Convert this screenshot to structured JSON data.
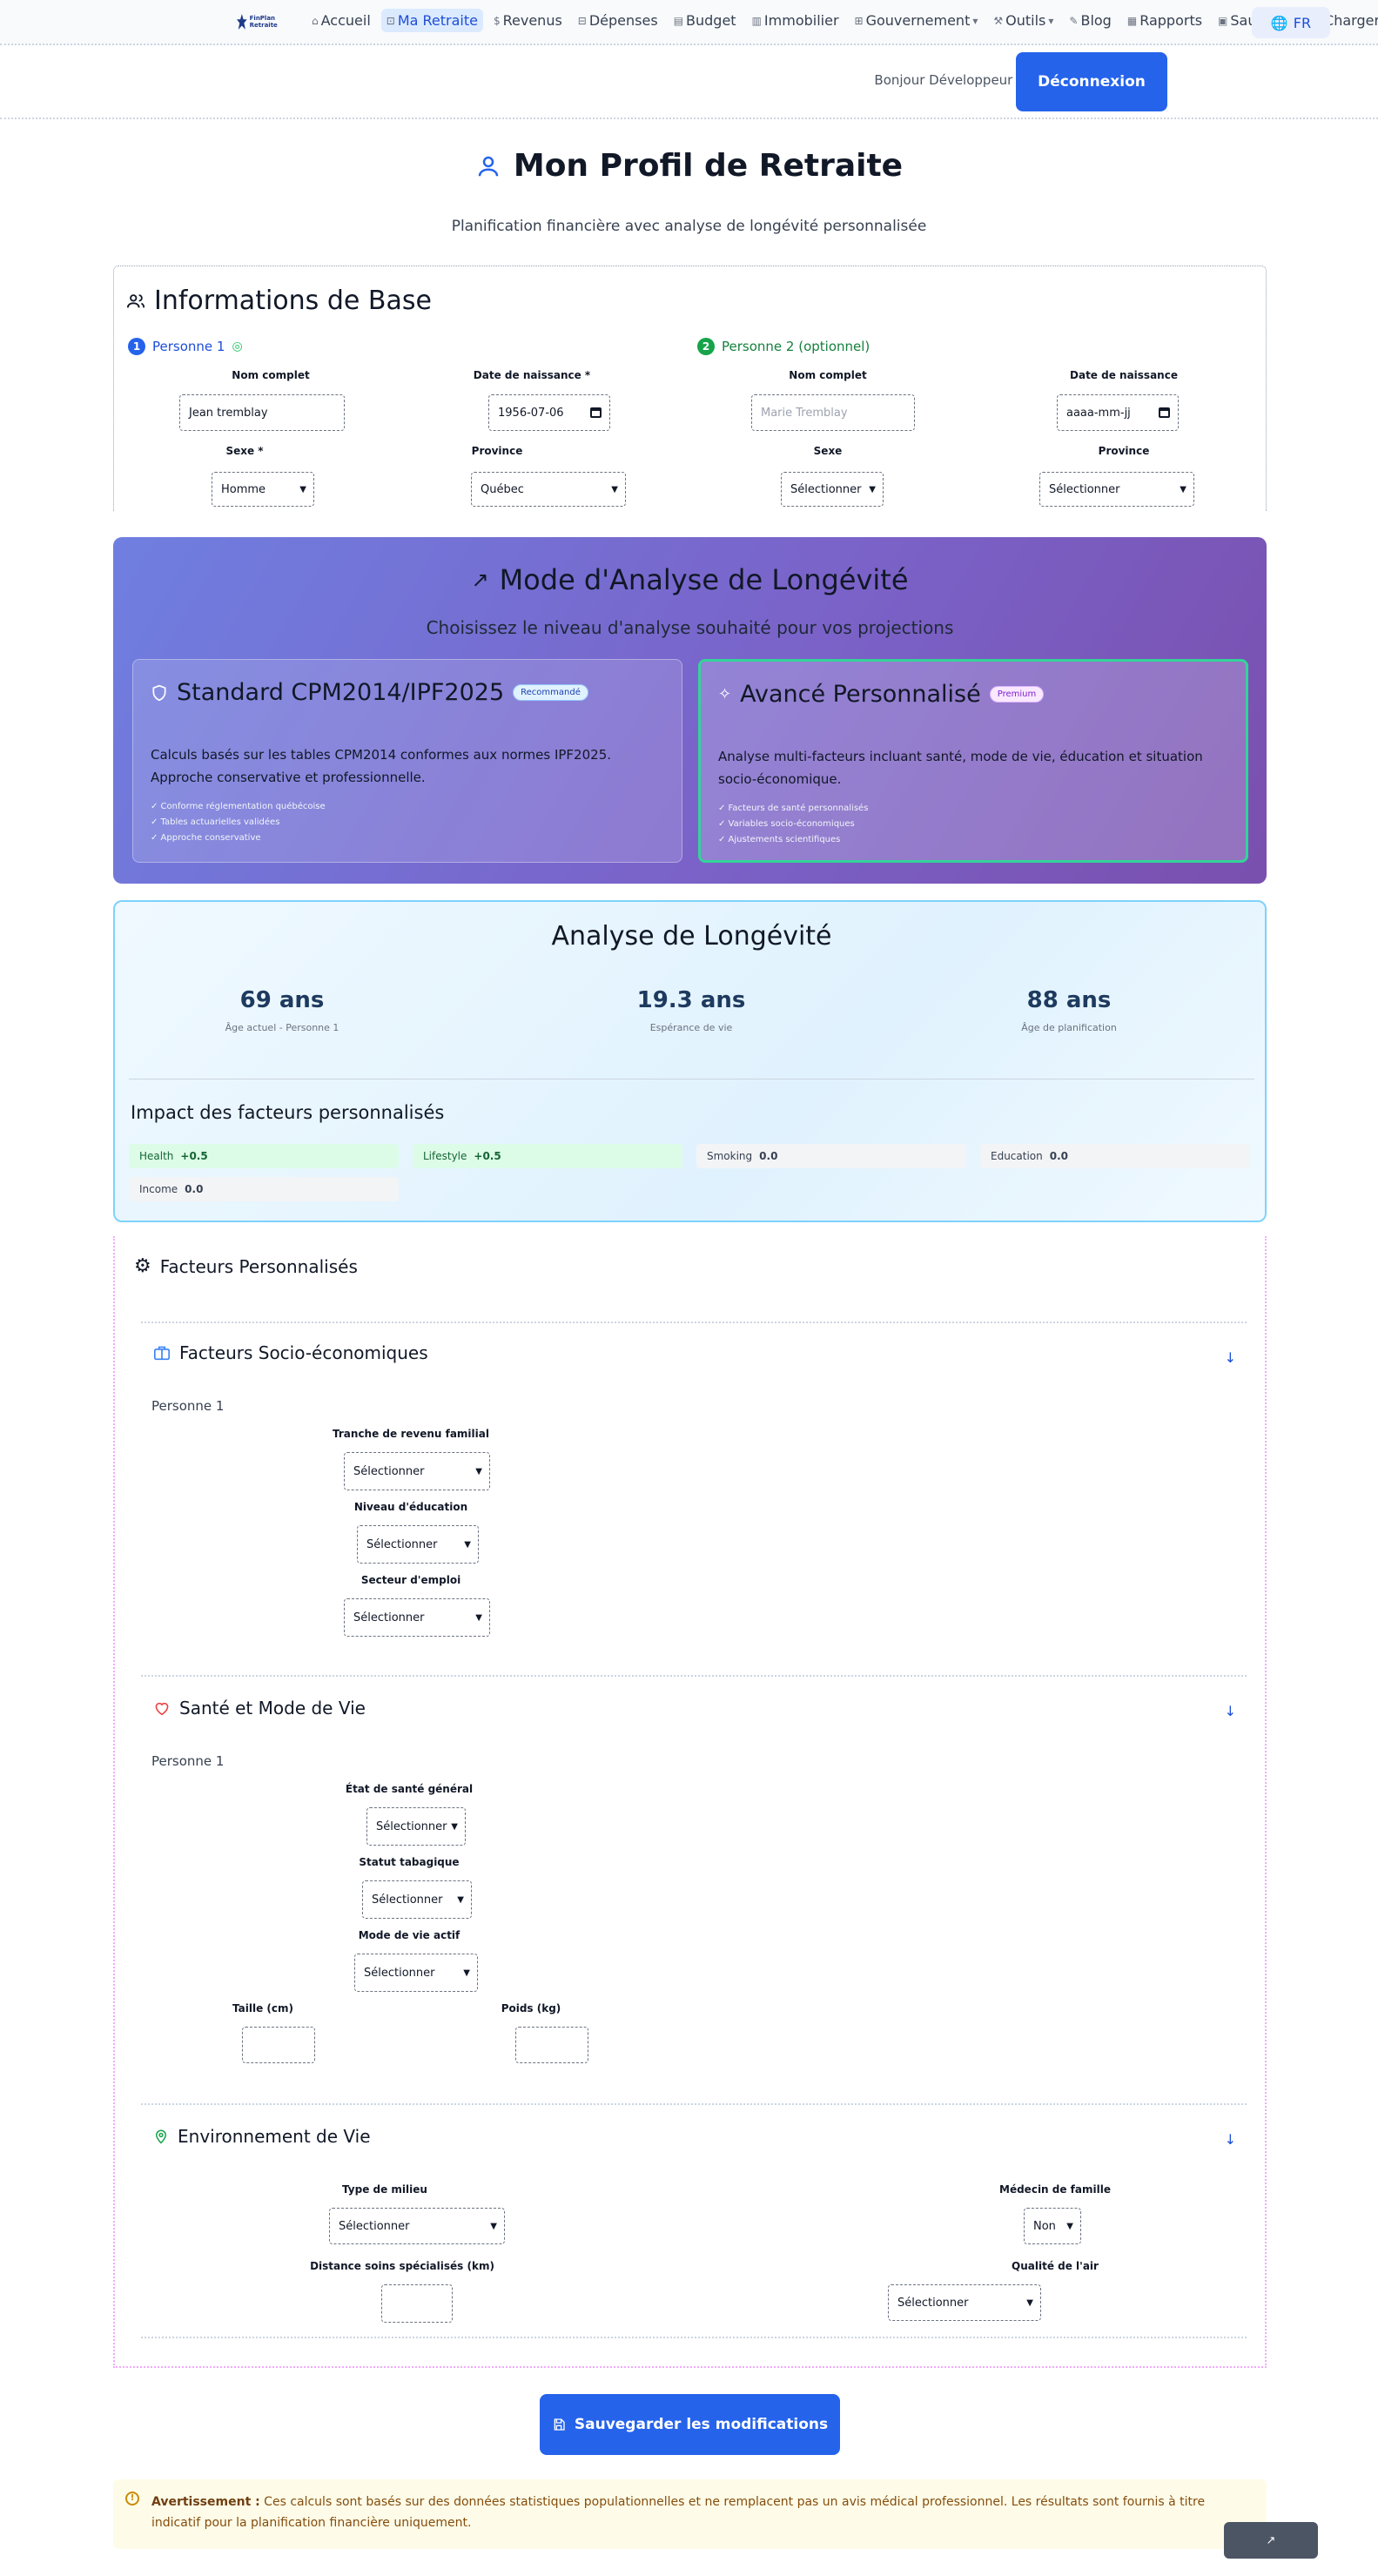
{
  "nav": {
    "logo_text": "FinPlan Retraite",
    "items": [
      {
        "icon": "home-icon",
        "label": "Accueil"
      },
      {
        "icon": "chart-icon",
        "label": "Ma Retraite"
      },
      {
        "icon": "dollar-icon",
        "label": "Revenus"
      },
      {
        "icon": "expense-icon",
        "label": "Dépenses"
      },
      {
        "icon": "budget-icon",
        "label": "Budget"
      },
      {
        "icon": "building-icon",
        "label": "Immobilier"
      },
      {
        "icon": "government-icon",
        "label": "Gouvernement"
      },
      {
        "icon": "tools-icon",
        "label": "Outils"
      },
      {
        "icon": "blog-icon",
        "label": "Blog"
      },
      {
        "icon": "reports-icon",
        "label": "Rapports"
      },
      {
        "icon": "save-icon",
        "label": "Sauvegarder/Charger"
      }
    ],
    "active_index": 1,
    "lang": "FR"
  },
  "user": {
    "greeting": "Bonjour Développeur Local",
    "logout": "Déconnexion"
  },
  "page": {
    "title": "Mon Profil de Retraite",
    "subtitle": "Planification financière avec analyse de longévité personnalisée"
  },
  "base_info": {
    "title": "Informations de Base",
    "person1": {
      "label": "Personne 1",
      "num": "1"
    },
    "person2": {
      "label": "Personne 2 (optionnel)",
      "num": "2"
    },
    "labels": {
      "name": "Nom complet",
      "dob_req": "Date de naissance *",
      "dob": "Date de naissance",
      "sex_req": "Sexe *",
      "sex": "Sexe",
      "province": "Province"
    },
    "p1": {
      "name": "Jean tremblay",
      "dob": "1956-07-06",
      "sex": "Homme",
      "province": "Québec"
    },
    "p2": {
      "name_placeholder": "Marie Tremblay",
      "dob_placeholder": "aaaa-mm-jj",
      "sex": "Sélectionner",
      "province": "Sélectionner"
    }
  },
  "mode": {
    "title": "Mode d'Analyse de Longévité",
    "subtitle": "Choisissez le niveau d'analyse souhaité pour vos projections",
    "standard": {
      "title": "Standard CPM2014/IPF2025",
      "badge": "Recommandé",
      "desc": "Calculs basés sur les tables CPM2014 conformes aux normes IPF2025. Approche conservative et professionnelle.",
      "bullets": [
        "✓ Conforme réglementation québécoise",
        "✓ Tables actuarielles validées",
        "✓ Approche conservative"
      ]
    },
    "advanced": {
      "title": "Avancé Personnalisé",
      "badge": "Premium",
      "desc": "Analyse multi-facteurs incluant santé, mode de vie, éducation et situation socio-économique.",
      "bullets": [
        "✓ Facteurs de santé personnalisés",
        "✓ Variables socio-économiques",
        "✓ Ajustements scientifiques"
      ]
    }
  },
  "analysis": {
    "title": "Analyse de Longévité",
    "stats": [
      {
        "value": "69 ans",
        "label": "Âge actuel - Personne 1"
      },
      {
        "value": "19.3 ans",
        "label": "Espérance de vie"
      },
      {
        "value": "88 ans",
        "label": "Âge de planification"
      }
    ],
    "impact_title": "Impact des facteurs personnalisés",
    "impacts": [
      {
        "name": "Health",
        "value": "+0.5",
        "kind": "pos"
      },
      {
        "name": "Lifestyle",
        "value": "+0.5",
        "kind": "pos"
      },
      {
        "name": "Smoking",
        "value": "0.0",
        "kind": "neu"
      },
      {
        "name": "Education",
        "value": "0.0",
        "kind": "neu"
      },
      {
        "name": "Income",
        "value": "0.0",
        "kind": "neu"
      }
    ]
  },
  "factors": {
    "title": "Facteurs Personnalisés",
    "socio": {
      "title": "Facteurs Socio-économiques",
      "person": "Personne 1",
      "income_label": "Tranche de revenu familial",
      "income": "Sélectionner",
      "edu_label": "Niveau d'éducation",
      "edu": "Sélectionner",
      "job_label": "Secteur d'emploi",
      "job": "Sélectionner"
    },
    "health": {
      "title": "Santé et Mode de Vie",
      "person": "Personne 1",
      "health_label": "État de santé général",
      "health": "Sélectionner",
      "smoke_label": "Statut tabagique",
      "smoke": "Sélectionner",
      "active_label": "Mode de vie actif",
      "active": "Sélectionner",
      "height_label": "Taille (cm)",
      "weight_label": "Poids (kg)"
    },
    "env": {
      "title": "Environnement de Vie",
      "milieu_label": "Type de milieu",
      "milieu": "Sélectionner",
      "doctor_label": "Médecin de famille",
      "doctor": "Non",
      "distance_label": "Distance soins spécialisés (km)",
      "air_label": "Qualité de l'air",
      "air": "Sélectionner"
    }
  },
  "save_button": "Sauvegarder les modifications",
  "warning": {
    "strong": "Avertissement :",
    "text": " Ces calculs sont basés sur des données statistiques populationnelles et ne remplacent pas un avis médical professionnel. Les résultats sont fournis à titre indicatif pour la planification financière uniquement."
  },
  "fab": "↗",
  "colors": {
    "primary": "#2563eb",
    "mode_gradient_start": "#6f7fe0",
    "mode_gradient_end": "#7a4fae",
    "positive": "#dcfce7",
    "selected_border": "#34d399"
  }
}
